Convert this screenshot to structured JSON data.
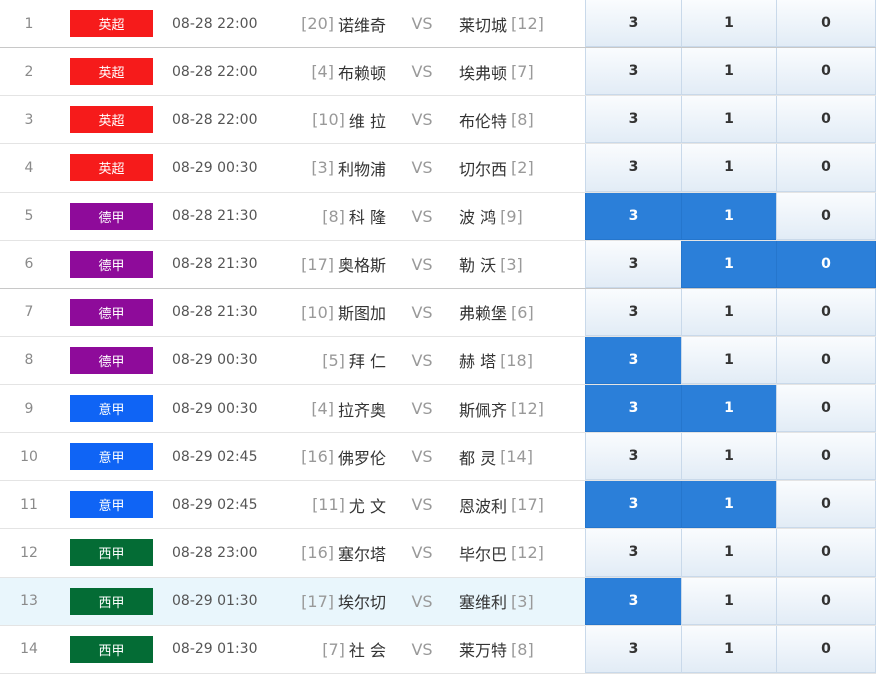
{
  "colors": {
    "yingchao": "#f61b1b",
    "dejia": "#8e0b9a",
    "yijia": "#0f64f5",
    "xijia": "#046c35",
    "selected": "#2b7fd9"
  },
  "matches": [
    {
      "no": "1",
      "league": "英超",
      "league_color": "#f61b1b",
      "time": "08-28 22:00",
      "home_rank": "[20]",
      "home": "诺维奇",
      "vs": "VS",
      "away": "莱切城",
      "away_rank": "[12]",
      "opts": [
        "3",
        "1",
        "0"
      ],
      "selected": [
        false,
        false,
        false
      ],
      "highlight": false,
      "sep": true
    },
    {
      "no": "2",
      "league": "英超",
      "league_color": "#f61b1b",
      "time": "08-28 22:00",
      "home_rank": "[4]",
      "home": "布赖顿",
      "vs": "VS",
      "away": "埃弗顿",
      "away_rank": "[7]",
      "opts": [
        "3",
        "1",
        "0"
      ],
      "selected": [
        false,
        false,
        false
      ],
      "highlight": false,
      "sep": false
    },
    {
      "no": "3",
      "league": "英超",
      "league_color": "#f61b1b",
      "time": "08-28 22:00",
      "home_rank": "[10]",
      "home": "维 拉",
      "vs": "VS",
      "away": "布伦特",
      "away_rank": "[8]",
      "opts": [
        "3",
        "1",
        "0"
      ],
      "selected": [
        false,
        false,
        false
      ],
      "highlight": false,
      "sep": false
    },
    {
      "no": "4",
      "league": "英超",
      "league_color": "#f61b1b",
      "time": "08-29 00:30",
      "home_rank": "[3]",
      "home": "利物浦",
      "vs": "VS",
      "away": "切尔西",
      "away_rank": "[2]",
      "opts": [
        "3",
        "1",
        "0"
      ],
      "selected": [
        false,
        false,
        false
      ],
      "highlight": false,
      "sep": false
    },
    {
      "no": "5",
      "league": "德甲",
      "league_color": "#8e0b9a",
      "time": "08-28 21:30",
      "home_rank": "[8]",
      "home": "科 隆",
      "vs": "VS",
      "away": "波 鸿",
      "away_rank": "[9]",
      "opts": [
        "3",
        "1",
        "0"
      ],
      "selected": [
        true,
        true,
        false
      ],
      "highlight": false,
      "sep": false
    },
    {
      "no": "6",
      "league": "德甲",
      "league_color": "#8e0b9a",
      "time": "08-28 21:30",
      "home_rank": "[17]",
      "home": "奥格斯",
      "vs": "VS",
      "away": "勒 沃",
      "away_rank": "[3]",
      "opts": [
        "3",
        "1",
        "0"
      ],
      "selected": [
        false,
        true,
        true
      ],
      "highlight": false,
      "sep": true
    },
    {
      "no": "7",
      "league": "德甲",
      "league_color": "#8e0b9a",
      "time": "08-28 21:30",
      "home_rank": "[10]",
      "home": "斯图加",
      "vs": "VS",
      "away": "弗赖堡",
      "away_rank": "[6]",
      "opts": [
        "3",
        "1",
        "0"
      ],
      "selected": [
        false,
        false,
        false
      ],
      "highlight": false,
      "sep": false
    },
    {
      "no": "8",
      "league": "德甲",
      "league_color": "#8e0b9a",
      "time": "08-29 00:30",
      "home_rank": "[5]",
      "home": "拜 仁",
      "vs": "VS",
      "away": "赫 塔",
      "away_rank": "[18]",
      "opts": [
        "3",
        "1",
        "0"
      ],
      "selected": [
        true,
        false,
        false
      ],
      "highlight": false,
      "sep": false
    },
    {
      "no": "9",
      "league": "意甲",
      "league_color": "#0f64f5",
      "time": "08-29 00:30",
      "home_rank": "[4]",
      "home": "拉齐奥",
      "vs": "VS",
      "away": "斯佩齐",
      "away_rank": "[12]",
      "opts": [
        "3",
        "1",
        "0"
      ],
      "selected": [
        true,
        true,
        false
      ],
      "highlight": false,
      "sep": false
    },
    {
      "no": "10",
      "league": "意甲",
      "league_color": "#0f64f5",
      "time": "08-29 02:45",
      "home_rank": "[16]",
      "home": "佛罗伦",
      "vs": "VS",
      "away": "都 灵",
      "away_rank": "[14]",
      "opts": [
        "3",
        "1",
        "0"
      ],
      "selected": [
        false,
        false,
        false
      ],
      "highlight": false,
      "sep": false
    },
    {
      "no": "11",
      "league": "意甲",
      "league_color": "#0f64f5",
      "time": "08-29 02:45",
      "home_rank": "[11]",
      "home": "尤 文",
      "vs": "VS",
      "away": "恩波利",
      "away_rank": "[17]",
      "opts": [
        "3",
        "1",
        "0"
      ],
      "selected": [
        true,
        true,
        false
      ],
      "highlight": false,
      "sep": false
    },
    {
      "no": "12",
      "league": "西甲",
      "league_color": "#046c35",
      "time": "08-28 23:00",
      "home_rank": "[16]",
      "home": "塞尔塔",
      "vs": "VS",
      "away": "毕尔巴",
      "away_rank": "[12]",
      "opts": [
        "3",
        "1",
        "0"
      ],
      "selected": [
        false,
        false,
        false
      ],
      "highlight": false,
      "sep": false
    },
    {
      "no": "13",
      "league": "西甲",
      "league_color": "#046c35",
      "time": "08-29 01:30",
      "home_rank": "[17]",
      "home": "埃尔切",
      "vs": "VS",
      "away": "塞维利",
      "away_rank": "[3]",
      "opts": [
        "3",
        "1",
        "0"
      ],
      "selected": [
        true,
        false,
        false
      ],
      "highlight": true,
      "sep": false
    },
    {
      "no": "14",
      "league": "西甲",
      "league_color": "#046c35",
      "time": "08-29 01:30",
      "home_rank": "[7]",
      "home": "社 会",
      "vs": "VS",
      "away": "莱万特",
      "away_rank": "[8]",
      "opts": [
        "3",
        "1",
        "0"
      ],
      "selected": [
        false,
        false,
        false
      ],
      "highlight": false,
      "sep": false
    }
  ]
}
